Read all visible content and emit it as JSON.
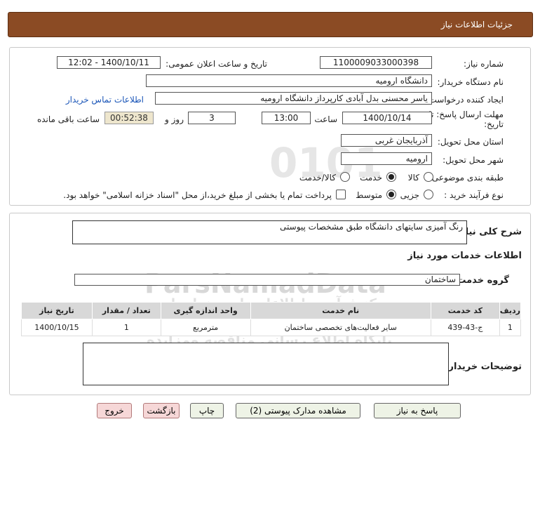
{
  "header": {
    "title": "جزئیات اطلاعات نیاز"
  },
  "form": {
    "need_number_label": "شماره نیاز:",
    "need_number": "1100009033000398",
    "announce_label": "تاریخ و ساعت اعلان عمومی:",
    "announce_value": "1400/10/11 - 12:02",
    "buyer_org_label": "نام دستگاه خریدار:",
    "buyer_org": "دانشگاه ارومیه",
    "requester_label": "ایجاد کننده درخواست:",
    "requester": "یاسر محسنی بدل آبادی کارپرداز دانشگاه ارومیه",
    "contact_link": "اطلاعات تماس خریدار",
    "deadline_label_1": "مهلت ارسال پاسخ: تا",
    "deadline_label_2": "تاریخ:",
    "deadline_date": "1400/10/14",
    "time_label": "ساعت",
    "deadline_time": "13:00",
    "days_value": "3",
    "days_label": "روز و",
    "remaining_time": "00:52:38",
    "remaining_label": "ساعت باقی مانده",
    "province_label": "استان محل تحویل:",
    "province": "آذربایجان غربی",
    "city_label": "شهر محل تحویل:",
    "city": "ارومیه",
    "category_label": "طبقه بندی موضوعی:",
    "category_options": [
      "کالا",
      "خدمت",
      "کالا/خدمت"
    ],
    "category_selected": "خدمت",
    "process_label": "نوع فرآیند خرید :",
    "process_options": [
      "جزیی",
      "متوسط"
    ],
    "process_selected": "متوسط",
    "payment_note": "پرداخت تمام یا بخشی از مبلغ خرید،از محل \"اسناد خزانه اسلامی\" خواهد بود."
  },
  "details": {
    "summary_label": "شرح کلی نیاز:",
    "summary": "رنگ آمیزی سایتهای دانشگاه طبق مشخصات پیوستی",
    "services_title": "اطلاعات خدمات مورد نیاز",
    "service_group_label": "گروه خدمت:",
    "service_group": "ساختمان",
    "table": {
      "headers": [
        "ردیف",
        "کد خدمت",
        "نام خدمت",
        "واحد اندازه گیری",
        "تعداد / مقدار",
        "تاریخ نیاز"
      ],
      "rows": [
        [
          "1",
          "ج-43-439",
          "سایر فعالیت‌های تخصصی ساختمان",
          "مترمربع",
          "1",
          "1400/10/15"
        ]
      ]
    },
    "buyer_notes_label": "توضیحات خریدار:",
    "buyer_notes": ""
  },
  "buttons": {
    "respond": "پاسخ به نیاز",
    "attachments": "مشاهده مدارک پیوستی (2)",
    "print": "چاپ",
    "back": "بازگشت",
    "exit": "خروج"
  },
  "watermark": {
    "line1": "ParsNamadData",
    "line2": "مرکز فرآوری اطلاعات پارس نماد داده",
    "line3": "پایگاه اطلاع رسانی مناقصه ومزایده",
    "line4": "۰۲۱-۸۸۳۴۹۶۷۰-۵"
  }
}
